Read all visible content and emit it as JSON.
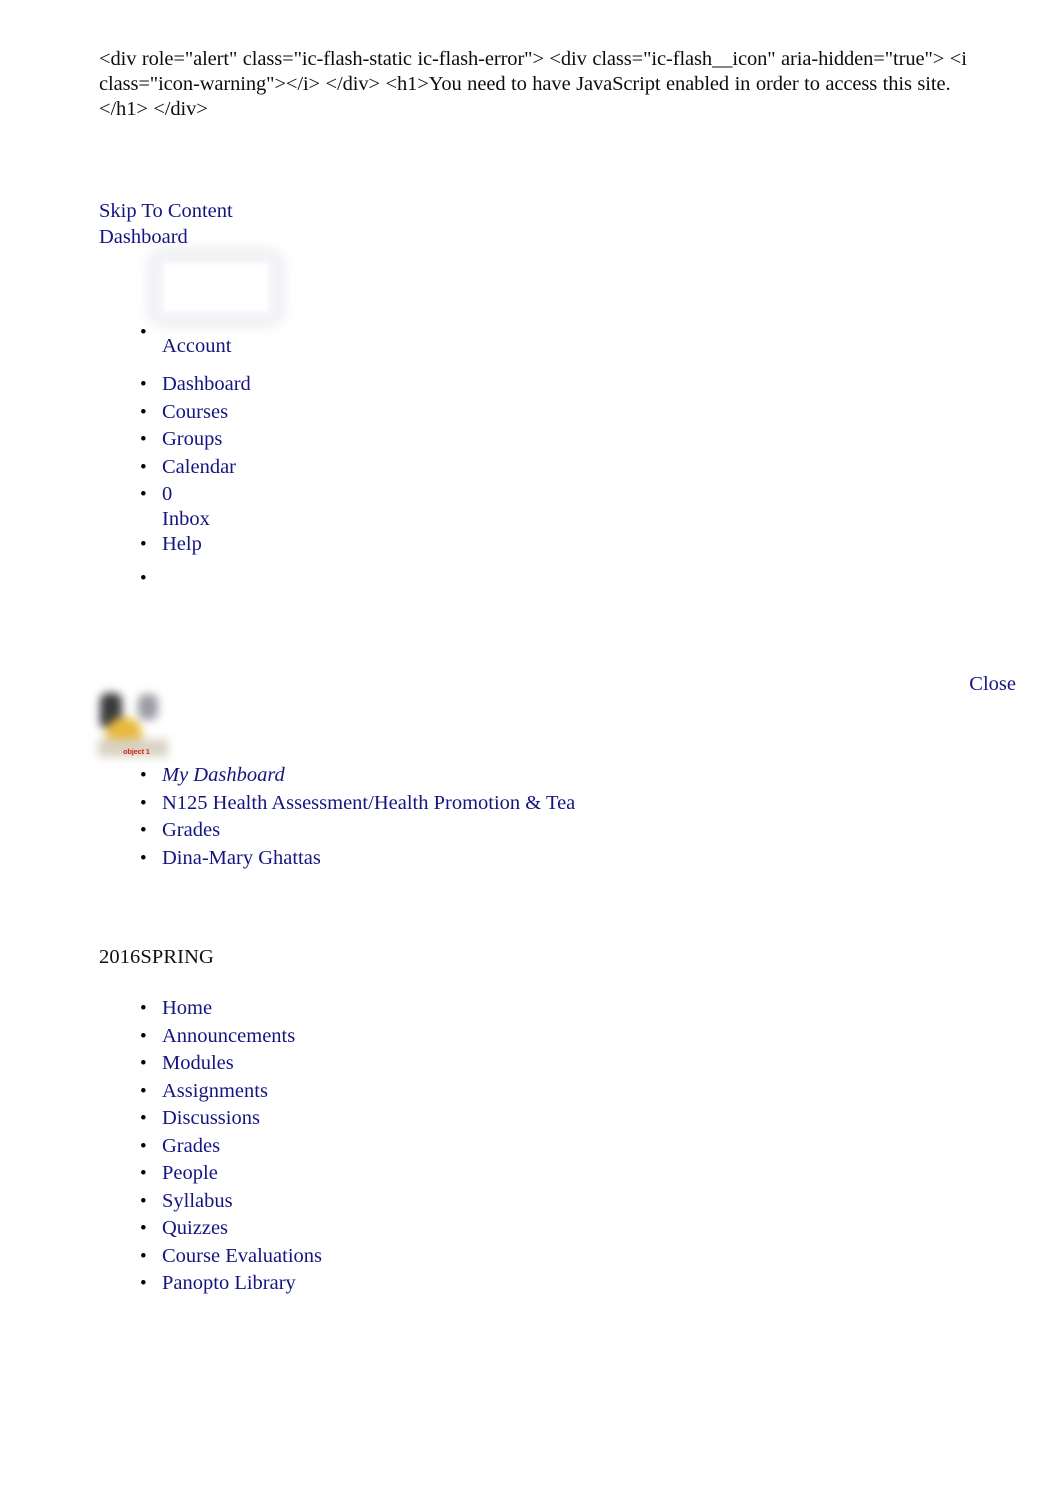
{
  "noscript": {
    "raw_html": "<div role=\"alert\" class=\"ic-flash-static ic-flash-error\"> <div class=\"ic-flash__icon\" aria-hidden=\"true\"> <i class=\"icon-warning\"></i> </div> <h1>You need to have JavaScript enabled in order to access this site.</h1> </div>"
  },
  "skip": {
    "skip_to_content": "Skip To Content",
    "dashboard": "Dashboard"
  },
  "global_nav": {
    "account": "Account",
    "dashboard": "Dashboard",
    "courses": "Courses",
    "groups": "Groups",
    "calendar": "Calendar",
    "inbox_count": "0",
    "inbox": "Inbox",
    "help": "Help"
  },
  "close": {
    "label": "Close"
  },
  "thumbnail": {
    "caption": "object 1"
  },
  "breadcrumb": {
    "items": [
      {
        "label": "My Dashboard"
      },
      {
        "label": "N125 Health Assessment/Health Promotion & Tea"
      },
      {
        "label": "Grades"
      },
      {
        "label": "Dina-Mary Ghattas"
      }
    ]
  },
  "term": {
    "heading": "2016SPRING"
  },
  "course_nav": {
    "items": [
      {
        "label": "Home"
      },
      {
        "label": "Announcements"
      },
      {
        "label": "Modules"
      },
      {
        "label": "Assignments"
      },
      {
        "label": "Discussions"
      },
      {
        "label": "Grades"
      },
      {
        "label": "People"
      },
      {
        "label": "Syllabus"
      },
      {
        "label": "Quizzes"
      },
      {
        "label": "Course Evaluations"
      },
      {
        "label": "Panopto Library"
      }
    ]
  },
  "colors": {
    "link": "#151580",
    "text": "#000000",
    "caption_red": "#d42a1c",
    "background": "#ffffff"
  }
}
